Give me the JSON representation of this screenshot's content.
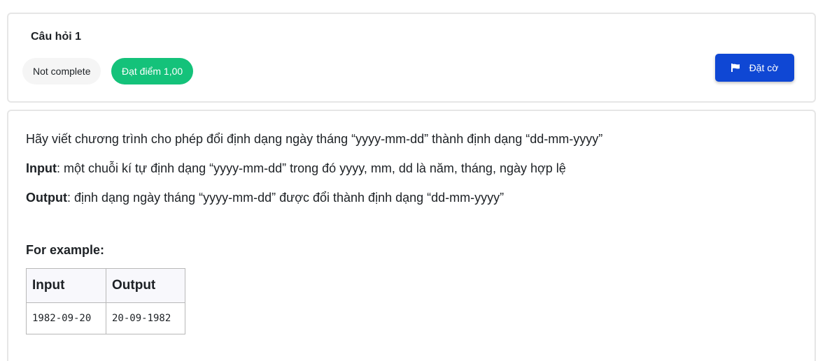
{
  "question": {
    "title": "Câu hỏi 1",
    "state": "Not complete",
    "grade": "Đạt điểm 1,00",
    "flag_label": "Đặt cờ",
    "flag_icon": "flag-icon"
  },
  "content": {
    "description": "Hãy viết chương trình cho phép đổi định dạng ngày tháng “yyyy-mm-dd” thành định dạng “dd-mm-yyyy”",
    "input_label": "Input",
    "input_text": ": một chuỗi kí tự định dạng “yyyy-mm-dd” trong đó yyyy, mm, dd là năm, tháng, ngày hợp lệ",
    "output_label": "Output",
    "output_text": ": định dạng ngày tháng “yyyy-mm-dd” được đổi thành định dạng “dd-mm-yyyy”",
    "example_heading": "For example:",
    "table": {
      "headers": [
        "Input",
        "Output"
      ],
      "rows": [
        [
          "1982-09-20",
          "20-09-1982"
        ]
      ]
    }
  },
  "colors": {
    "grade_badge": "#14c27a",
    "flag_button": "#0f47d4",
    "state_badge": "#f5f5f5"
  }
}
